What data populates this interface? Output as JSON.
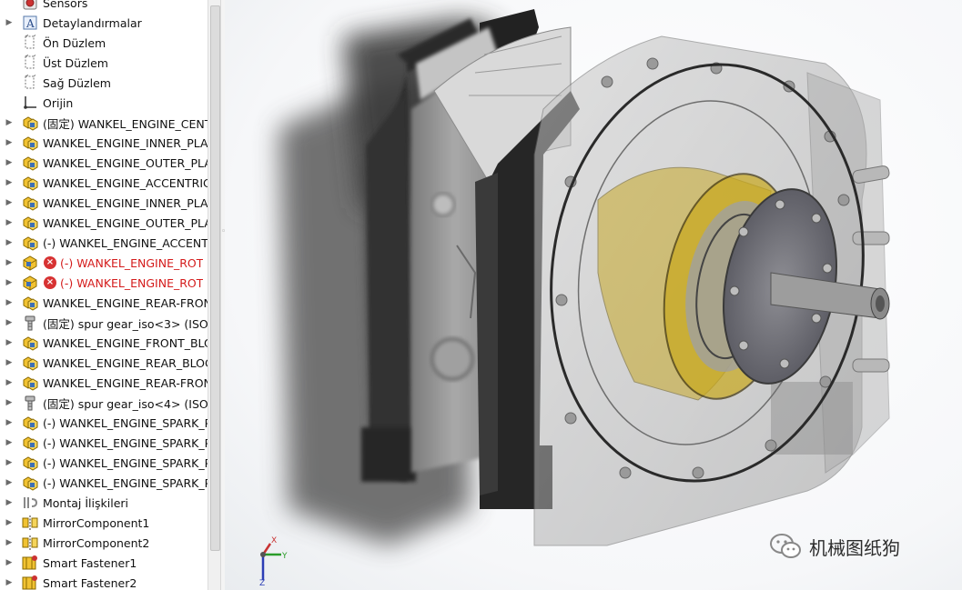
{
  "tree": {
    "items": [
      {
        "label": "Sensors",
        "icon": "sensor-icon",
        "toggle": false,
        "error": false
      },
      {
        "label": "Detaylandırmalar",
        "icon": "annotation-icon",
        "toggle": true,
        "error": false
      },
      {
        "label": "Ön Düzlem",
        "icon": "plane-icon",
        "toggle": false,
        "error": false
      },
      {
        "label": "Üst Düzlem",
        "icon": "plane-icon",
        "toggle": false,
        "error": false
      },
      {
        "label": "Sağ Düzlem",
        "icon": "plane-icon",
        "toggle": false,
        "error": false
      },
      {
        "label": "Orijin",
        "icon": "origin-icon",
        "toggle": false,
        "error": false
      },
      {
        "label": "(固定) WANKEL_ENGINE_CENT",
        "icon": "subassembly-icon",
        "toggle": true,
        "error": false
      },
      {
        "label": "WANKEL_ENGINE_INNER_PLA",
        "icon": "subassembly-icon",
        "toggle": true,
        "error": false
      },
      {
        "label": "WANKEL_ENGINE_OUTER_PLA",
        "icon": "subassembly-icon",
        "toggle": true,
        "error": false
      },
      {
        "label": "WANKEL_ENGINE_ACCENTRIC",
        "icon": "subassembly-icon",
        "toggle": true,
        "error": false
      },
      {
        "label": "WANKEL_ENGINE_INNER_PLA",
        "icon": "subassembly-icon",
        "toggle": true,
        "error": false
      },
      {
        "label": "WANKEL_ENGINE_OUTER_PLA",
        "icon": "subassembly-icon",
        "toggle": true,
        "error": false
      },
      {
        "label": "(-) WANKEL_ENGINE_ACCENT",
        "icon": "subassembly-icon",
        "toggle": true,
        "error": false
      },
      {
        "label": "(-) WANKEL_ENGINE_ROT",
        "icon": "part-icon",
        "toggle": true,
        "error": true
      },
      {
        "label": "(-) WANKEL_ENGINE_ROT",
        "icon": "part-icon",
        "toggle": true,
        "error": true
      },
      {
        "label": "WANKEL_ENGINE_REAR-FRON",
        "icon": "subassembly-icon",
        "toggle": true,
        "error": false
      },
      {
        "label": "(固定) spur gear_iso<3> (ISO",
        "icon": "toolbox-icon",
        "toggle": true,
        "error": false
      },
      {
        "label": "WANKEL_ENGINE_FRONT_BLO",
        "icon": "subassembly-icon",
        "toggle": true,
        "error": false
      },
      {
        "label": "WANKEL_ENGINE_REAR_BLOC",
        "icon": "subassembly-icon",
        "toggle": true,
        "error": false
      },
      {
        "label": "WANKEL_ENGINE_REAR-FRON",
        "icon": "subassembly-icon",
        "toggle": true,
        "error": false
      },
      {
        "label": "(固定) spur gear_iso<4> (ISO",
        "icon": "toolbox-icon",
        "toggle": true,
        "error": false
      },
      {
        "label": "(-) WANKEL_ENGINE_SPARK_P",
        "icon": "subassembly-icon",
        "toggle": true,
        "error": false
      },
      {
        "label": "(-) WANKEL_ENGINE_SPARK_P",
        "icon": "subassembly-icon",
        "toggle": true,
        "error": false
      },
      {
        "label": "(-) WANKEL_ENGINE_SPARK_P",
        "icon": "subassembly-icon",
        "toggle": true,
        "error": false
      },
      {
        "label": "(-) WANKEL_ENGINE_SPARK_P",
        "icon": "subassembly-icon",
        "toggle": true,
        "error": false
      },
      {
        "label": "Montaj İlişkileri",
        "icon": "mates-icon",
        "toggle": true,
        "error": false
      },
      {
        "label": "MirrorComponent1",
        "icon": "mirror-component-icon",
        "toggle": true,
        "error": false
      },
      {
        "label": "MirrorComponent2",
        "icon": "mirror-component-icon",
        "toggle": true,
        "error": false
      },
      {
        "label": "Smart Fastener1",
        "icon": "smart-fastener-icon",
        "toggle": true,
        "error": false
      },
      {
        "label": "Smart Fastener2",
        "icon": "smart-fastener-icon",
        "toggle": true,
        "error": false
      }
    ]
  },
  "triad": {
    "x": "X",
    "y": "Y",
    "z": "Z"
  },
  "watermark": {
    "text": "机械图纸狗",
    "icon": "wechat-icon"
  },
  "colors": {
    "error": "#d41c1c",
    "part_yellow": "#f1c232",
    "part_blue": "#3d6fb5"
  }
}
